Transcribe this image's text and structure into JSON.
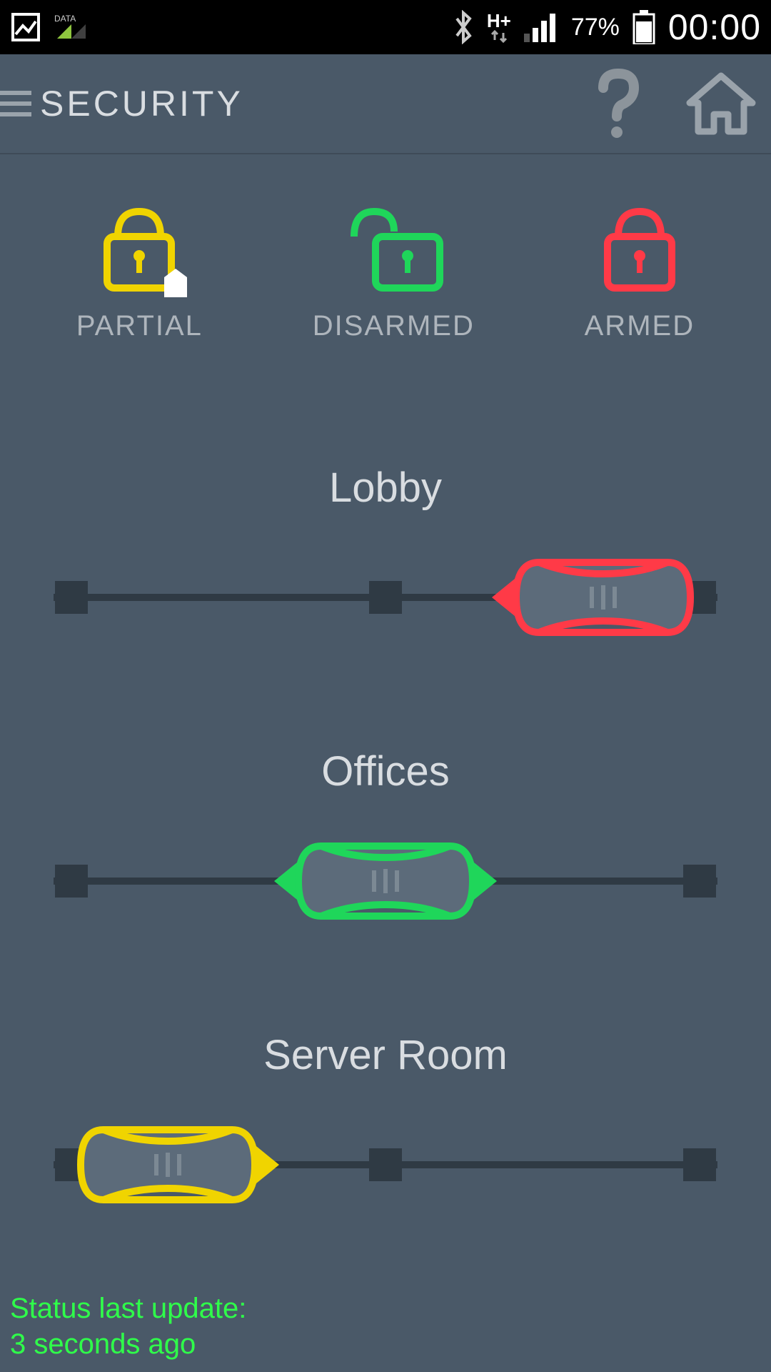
{
  "status_bar": {
    "network_label": "H+",
    "battery_percent": "77%",
    "clock": "00:00"
  },
  "header": {
    "title": "SECURITY"
  },
  "modes": {
    "partial": {
      "label": "PARTIAL",
      "color": "#f0d400"
    },
    "disarmed": {
      "label": "DISARMED",
      "color": "#1fd65a"
    },
    "armed": {
      "label": "ARMED",
      "color": "#ff3a47"
    }
  },
  "zones": [
    {
      "name": "Lobby",
      "handle_pos": "right",
      "handle_color": "#ff3a47",
      "arrows": [
        "left"
      ]
    },
    {
      "name": "Offices",
      "handle_pos": "center",
      "handle_color": "#1fd65a",
      "arrows": [
        "left",
        "right"
      ]
    },
    {
      "name": "Server Room",
      "handle_pos": "left",
      "handle_color": "#f0d400",
      "arrows": [
        "right"
      ]
    }
  ],
  "footer": {
    "line1": "Status last update:",
    "line2": "3 seconds ago"
  }
}
